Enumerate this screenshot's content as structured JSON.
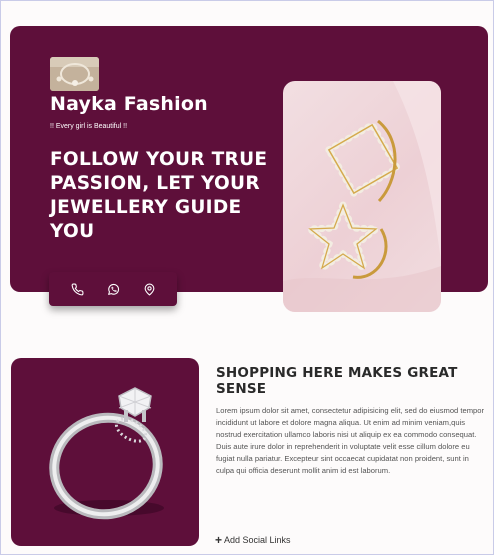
{
  "hero": {
    "brand": "Nayka Fashion",
    "tagline": "!! Every girl is Beautiful !!",
    "headline": "FOLLOW YOUR TRUE PASSION, LET YOUR JEWELLERY GUIDE YOU"
  },
  "contact_icons": [
    "phone-icon",
    "whatsapp-icon",
    "location-pin-icon"
  ],
  "section": {
    "title": "SHOPPING HERE MAKES GREAT SENSE",
    "body": "Lorem ipsum dolor sit amet, consectetur adipisicing elit, sed do eiusmod tempor incididunt ut labore et dolore magna aliqua. Ut enim ad minim veniam,quis nostrud exercitation ullamco laboris nisi ut aliquip ex ea commodo consequat. Duis aute irure dolor in reprehenderit in voluptate velit esse cillum dolore eu fugiat nulla pariatur. Excepteur sint occaecat cupidatat non proident, sunt in culpa qui officia deserunt mollit anim id est laborum.",
    "social_link": "Add Social Links"
  },
  "colors": {
    "accent": "#5e0f3a",
    "text_dark": "#2a2a2a",
    "page_bg": "#fdfbfb"
  }
}
